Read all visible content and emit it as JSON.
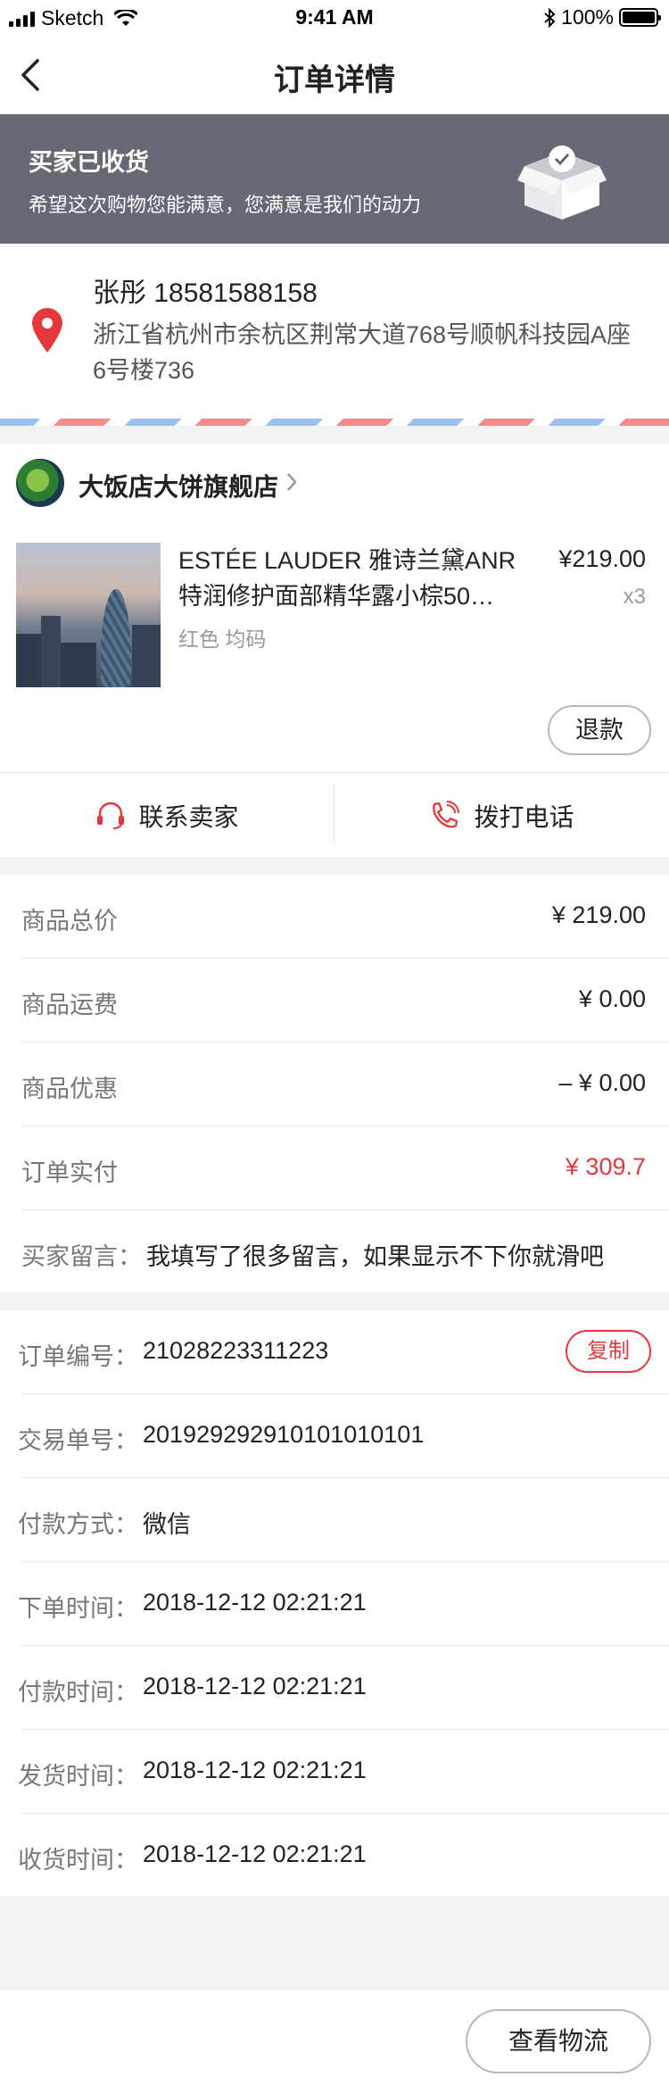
{
  "status_bar": {
    "carrier": "Sketch",
    "time": "9:41 AM",
    "battery": "100%",
    "battery_level": 1.0
  },
  "nav": {
    "title": "订单详情",
    "back_icon": "chevron-left-icon"
  },
  "banner": {
    "title": "买家已收货",
    "subtitle": "希望这次购物您能满意，您满意是我们的动力",
    "icon": "box-check-icon"
  },
  "address": {
    "name_phone": "张彤  18581588158",
    "detail": "浙江省杭州市余杭区荆常大道768号顺帆科技园A座6号楼736",
    "icon": "location-pin-icon"
  },
  "shop": {
    "name": "大饭店大饼旗舰店"
  },
  "product": {
    "title": "ESTÉE LAUDER 雅诗兰黛ANR特润修护面部精华露小棕50…",
    "spec": "红色 均码",
    "price": "¥219.00",
    "quantity": "x3",
    "refund_label": "退款"
  },
  "contact": {
    "seller_label": "联系卖家",
    "call_label": "拨打电话"
  },
  "prices": [
    {
      "label": "商品总价",
      "value": "¥ 219.00"
    },
    {
      "label": "商品运费",
      "value": "¥ 0.00"
    },
    {
      "label": "商品优惠",
      "value": "– ¥ 0.00"
    },
    {
      "label": "订单实付",
      "value": "¥ 309.7"
    }
  ],
  "note": {
    "label": "买家留言：",
    "text": "我填写了很多留言，如果显示不下你就滑吧"
  },
  "order_info": {
    "copy_label": "复制",
    "rows": [
      {
        "label": "订单编号：",
        "value": "21028223311223"
      },
      {
        "label": "交易单号：",
        "value": "201929292910101010101"
      },
      {
        "label": "付款方式：",
        "value": "微信"
      },
      {
        "label": "下单时间：",
        "value": "2018-12-12 02:21:21"
      },
      {
        "label": "付款时间：",
        "value": "2018-12-12 02:21:21"
      },
      {
        "label": "发货时间：",
        "value": "2018-12-12 02:21:21"
      },
      {
        "label": "收货时间：",
        "value": "2018-12-12 02:21:21"
      }
    ]
  },
  "bottom": {
    "logistics_label": "查看物流"
  },
  "colors": {
    "accent_red": "#e4393c",
    "banner_bg": "#666873",
    "page_bg": "#f2f2f4"
  }
}
